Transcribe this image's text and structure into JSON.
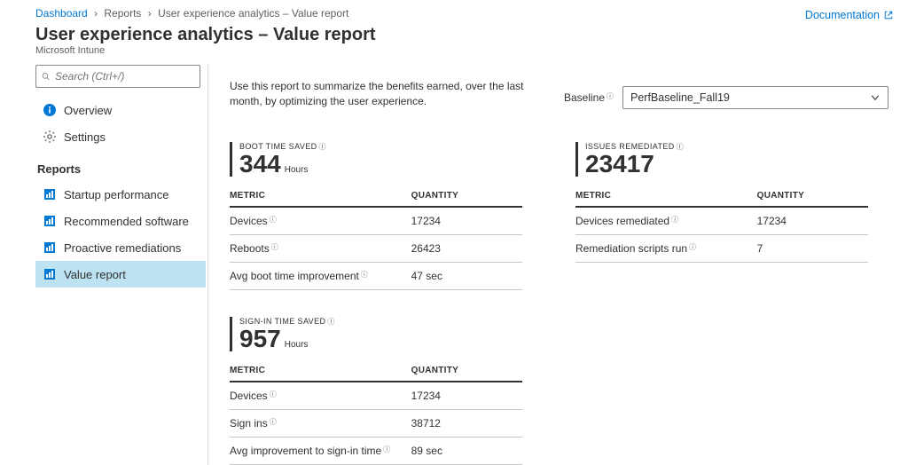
{
  "breadcrumb": {
    "items": [
      {
        "label": "Dashboard",
        "link": true
      },
      {
        "label": "Reports",
        "link": false
      },
      {
        "label": "User experience analytics – Value report",
        "link": false
      }
    ]
  },
  "header": {
    "documentation_label": "Documentation",
    "title": "User experience analytics – Value report",
    "subtitle": "Microsoft Intune"
  },
  "sidebar": {
    "search_placeholder": "Search (Ctrl+/)",
    "nav": [
      {
        "label": "Overview",
        "icon": "info"
      },
      {
        "label": "Settings",
        "icon": "gear"
      }
    ],
    "section_label": "Reports",
    "reports": [
      {
        "label": "Startup performance",
        "active": false
      },
      {
        "label": "Recommended software",
        "active": false
      },
      {
        "label": "Proactive remediations",
        "active": false
      },
      {
        "label": "Value report",
        "active": true
      }
    ]
  },
  "content": {
    "intro": "Use this report to summarize the benefits earned, over the last month, by optimizing the user experience.",
    "baseline_label": "Baseline",
    "baseline_value": "PerfBaseline_Fall19",
    "table_headers": {
      "metric": "METRIC",
      "quantity": "QUANTITY"
    },
    "cards": {
      "boot": {
        "title": "BOOT TIME SAVED",
        "value": "344",
        "unit": "Hours",
        "rows": [
          {
            "metric": "Devices",
            "quantity": "17234"
          },
          {
            "metric": "Reboots",
            "quantity": "26423"
          },
          {
            "metric": "Avg boot time improvement",
            "quantity": "47 sec"
          }
        ]
      },
      "issues": {
        "title": "ISSUES REMEDIATED",
        "value": "23417",
        "unit": "",
        "rows": [
          {
            "metric": "Devices remediated",
            "quantity": "17234"
          },
          {
            "metric": "Remediation scripts run",
            "quantity": "7"
          }
        ]
      },
      "signin": {
        "title": "SIGN-IN TIME SAVED",
        "value": "957",
        "unit": "Hours",
        "rows": [
          {
            "metric": "Devices",
            "quantity": "17234"
          },
          {
            "metric": "Sign ins",
            "quantity": "38712"
          },
          {
            "metric": "Avg improvement to sign-in time",
            "quantity": "89 sec"
          }
        ]
      }
    }
  }
}
